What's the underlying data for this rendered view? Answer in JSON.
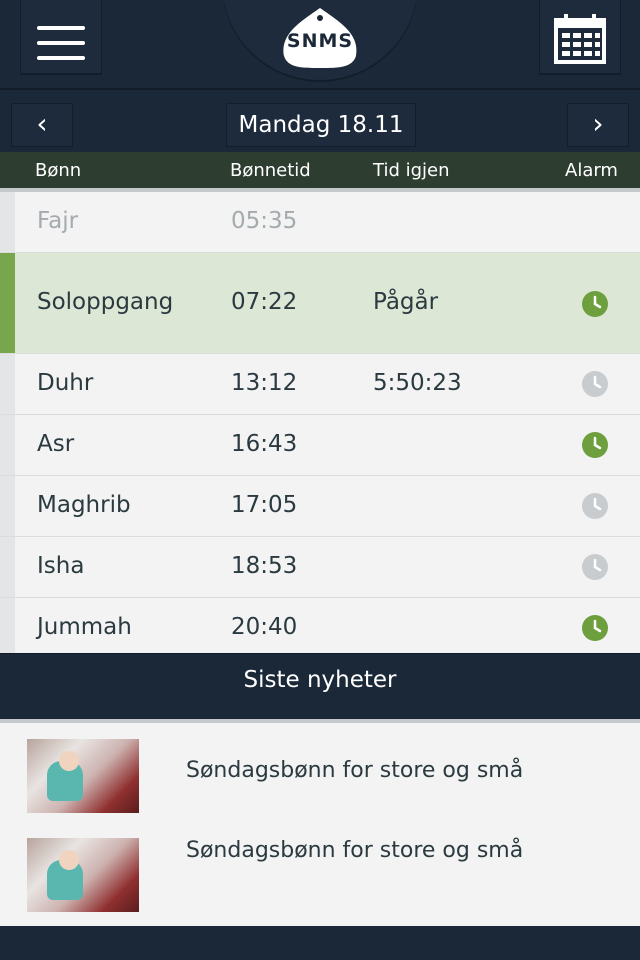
{
  "header": {
    "logo_text": "SNMS",
    "menu_icon": "hamburger-menu-icon",
    "calendar_icon": "calendar-icon"
  },
  "datebar": {
    "prev": "‹",
    "date": "Mandag 18.11",
    "next": "›"
  },
  "columns": {
    "prayer": "Bønn",
    "time": "Bønnetid",
    "remaining": "Tid igjen",
    "alarm": "Alarm"
  },
  "prayers": [
    {
      "name": "Fajr",
      "time": "05:35",
      "remaining": "",
      "alarm": null
    },
    {
      "name": "Soloppgang",
      "time": "07:22",
      "remaining": "Pågår",
      "alarm": true
    },
    {
      "name": "Duhr",
      "time": "13:12",
      "remaining": "5:50:23",
      "alarm": false
    },
    {
      "name": "Asr",
      "time": "16:43",
      "remaining": "",
      "alarm": true
    },
    {
      "name": "Maghrib",
      "time": "17:05",
      "remaining": "",
      "alarm": false
    },
    {
      "name": "Isha",
      "time": "18:53",
      "remaining": "",
      "alarm": false
    },
    {
      "name": "Jummah",
      "time": "20:40",
      "remaining": "",
      "alarm": true
    }
  ],
  "news": {
    "heading": "Siste nyheter",
    "items": [
      {
        "title": "Søndagsbønn for store og små"
      },
      {
        "title": "Søndagsbønn for store og små"
      }
    ]
  },
  "colors": {
    "header_bg": "#1b2838",
    "accent_green": "#6e9f3e",
    "active_row": "#dde7d6",
    "column_header": "#2d3e31"
  }
}
